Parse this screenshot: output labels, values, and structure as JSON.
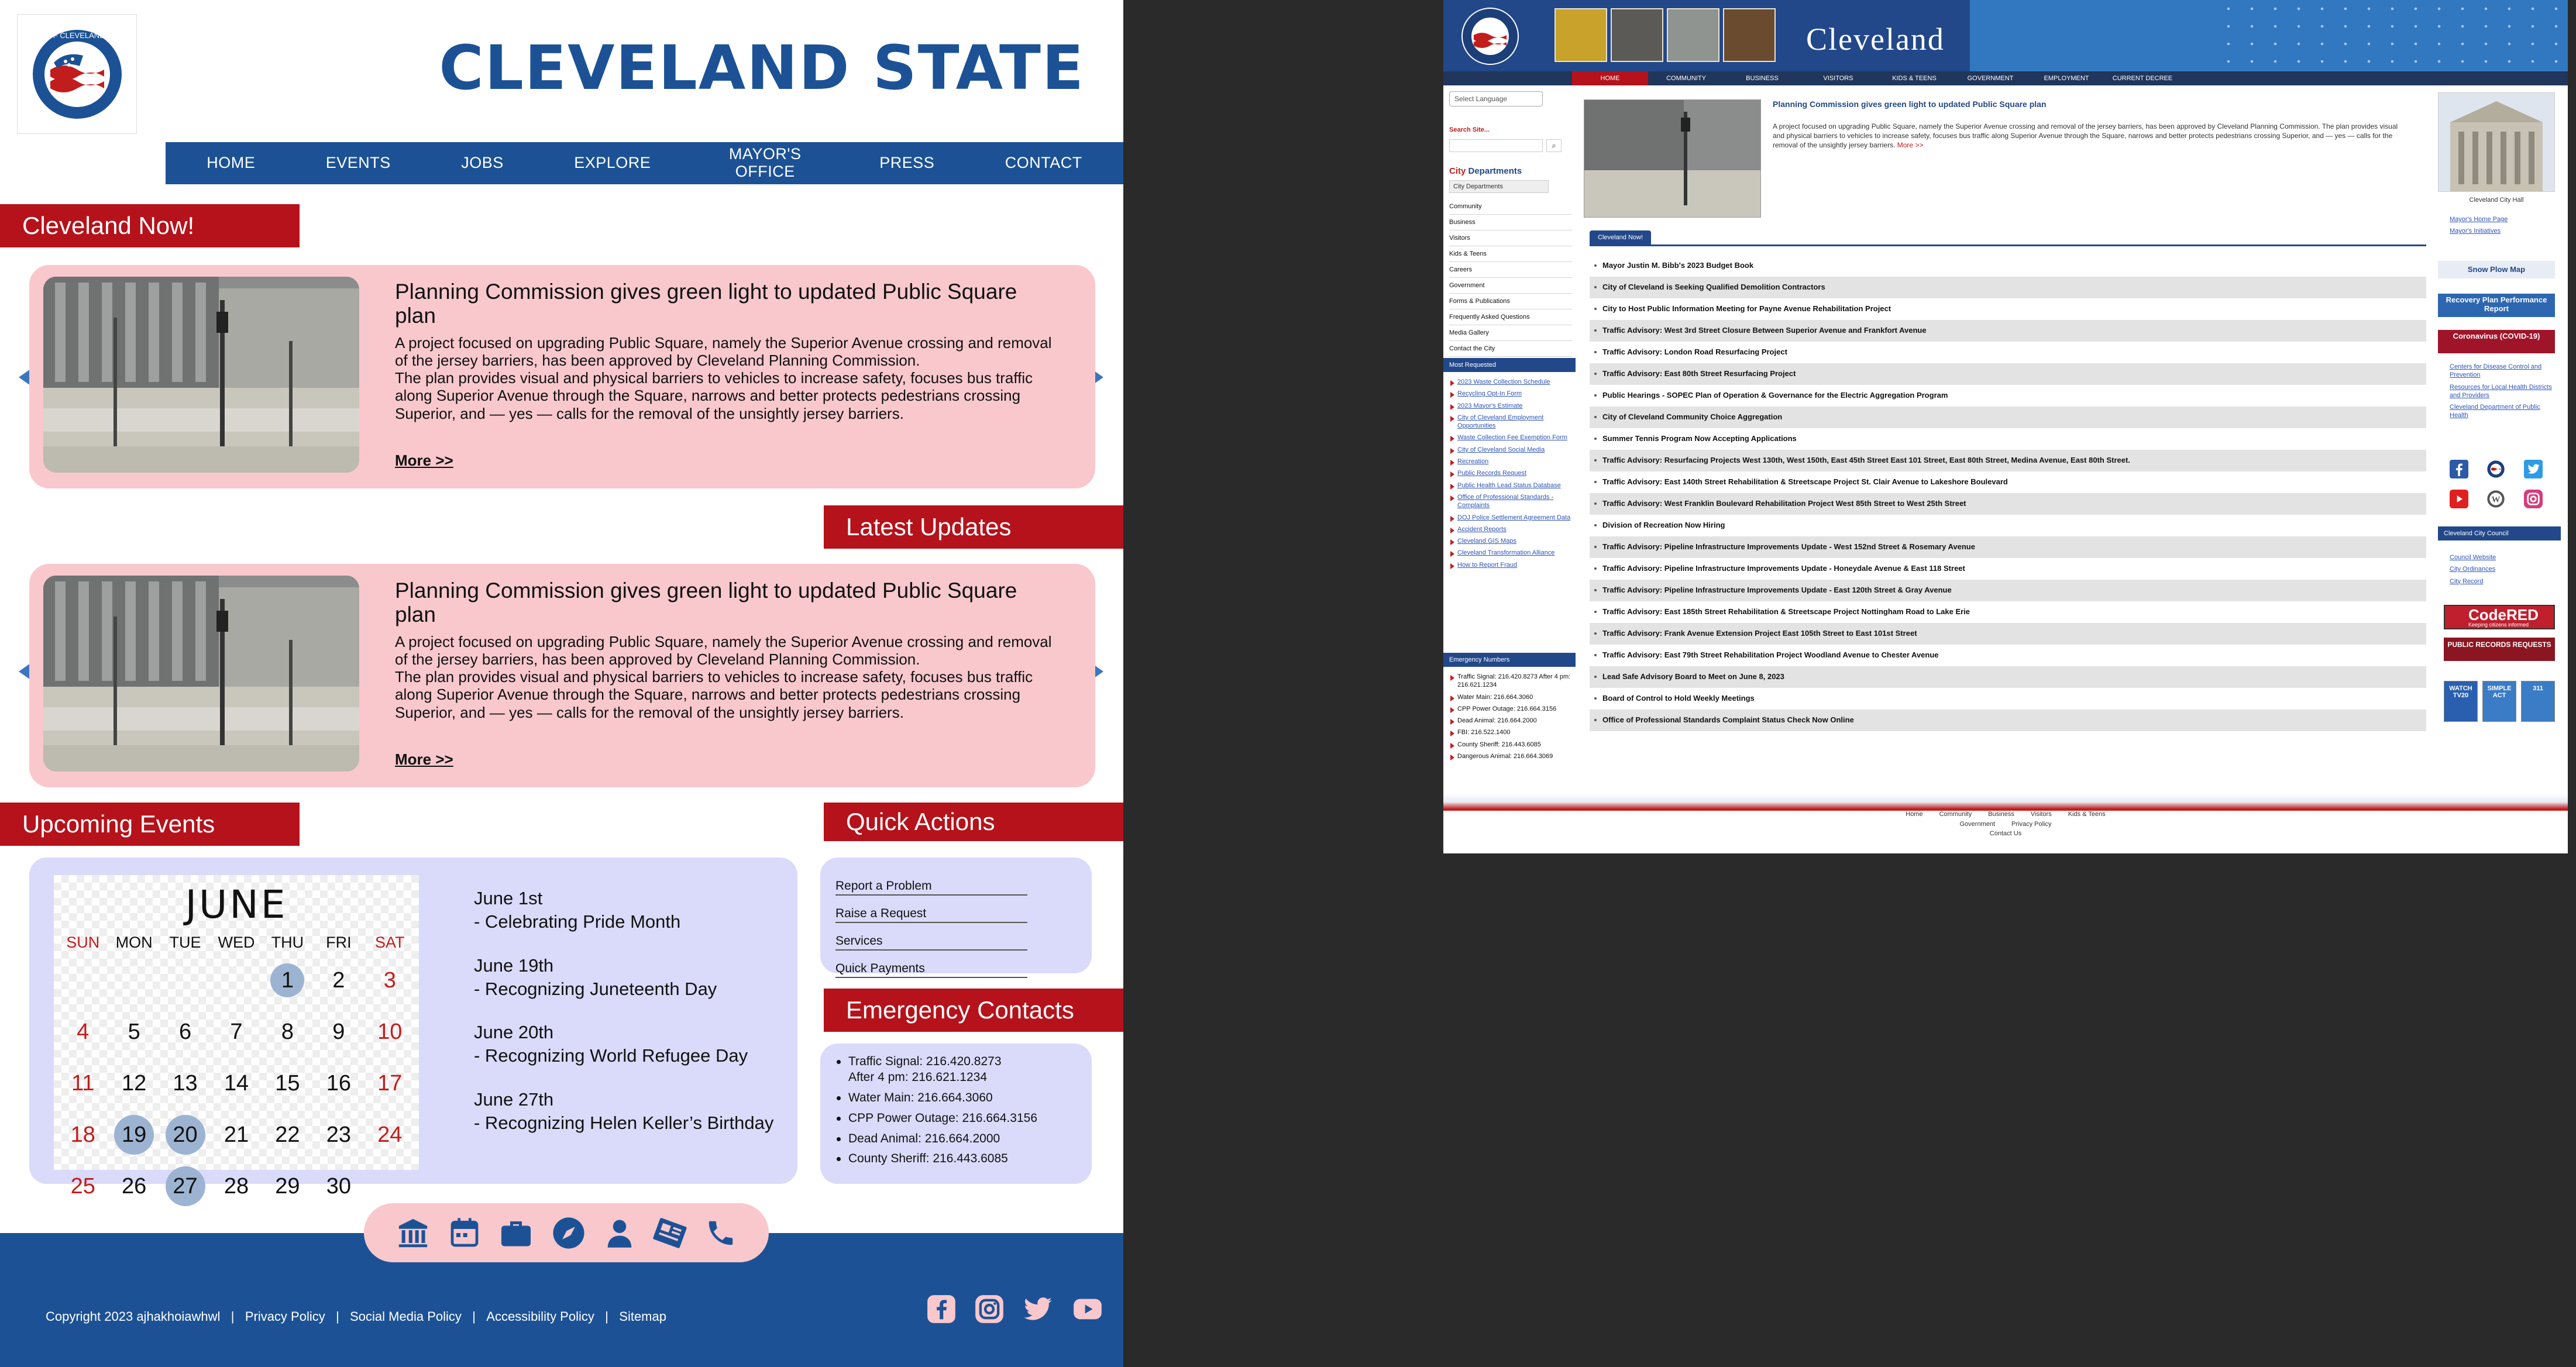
{
  "left": {
    "brand": "CLEVELAND STATE",
    "nav": [
      "HOME",
      "EVENTS",
      "JOBS",
      "EXPLORE",
      "MAYOR'S OFFICE",
      "PRESS",
      "CONTACT"
    ],
    "sections": {
      "now": "Cleveland Now!",
      "latest": "Latest Updates",
      "events": "Upcoming Events",
      "quick": "Quick Actions",
      "emergency": "Emergency Contacts"
    },
    "article": {
      "title": "Planning Commission gives green light to updated Public Square plan",
      "body": "A project focused on upgrading Public Square,  namely the Superior Avenue crossing and removal of the jersey barriers,  has been approved by Cleveland Planning Commission.\nThe plan provides visual and physical barriers to vehicles to increase safety, focuses bus traffic along Superior Avenue through the Square, narrows and better protects pedestrians crossing Superior,  and — yes — calls for the removal of the unsightly jersey barriers.",
      "more": "More >>"
    },
    "calendar": {
      "month": "JUNE",
      "days_of_week": [
        "SUN",
        "MON",
        "TUE",
        "WED",
        "THU",
        "FRI",
        "SAT"
      ],
      "dates": [
        "",
        "",
        "",
        "",
        "1",
        "2",
        "3",
        "4",
        "5",
        "6",
        "7",
        "8",
        "9",
        "10",
        "11",
        "12",
        "13",
        "14",
        "15",
        "16",
        "17",
        "18",
        "19",
        "20",
        "21",
        "22",
        "23",
        "24",
        "25",
        "26",
        "27",
        "28",
        "29",
        "30",
        ""
      ],
      "highlighted": [
        "1",
        "19",
        "20",
        "27"
      ]
    },
    "events": [
      {
        "date": "June 1st",
        "name": "- Celebrating Pride Month"
      },
      {
        "date": "June 19th",
        "name": "- Recognizing Juneteenth Day"
      },
      {
        "date": "June 20th",
        "name": "- Recognizing World Refugee Day"
      },
      {
        "date": "June 27th",
        "name": "- Recognizing Helen Keller’s Birthday"
      }
    ],
    "quick_actions": [
      "Report a Problem",
      "Raise a Request",
      "Services",
      "Quick Payments"
    ],
    "emergency": [
      "Traffic Signal: 216.420.8273\nAfter 4 pm: 216.621.1234",
      "Water Main: 216.664.3060",
      "CPP Power Outage: 216.664.3156",
      "Dead Animal: 216.664.2000",
      "County Sheriff: 216.443.6085"
    ],
    "icon_bar": [
      "building-icon",
      "calendar-icon",
      "briefcase-icon",
      "compass-icon",
      "user-icon",
      "newspaper-icon",
      "phone-icon"
    ],
    "footer": {
      "copyright": "Copyright 2023 ajhakhoiawhwl",
      "links": [
        "Privacy Policy",
        "Social Media Policy",
        "Accessibility Policy",
        "Sitemap"
      ],
      "social": [
        "facebook-icon",
        "instagram-icon",
        "twitter-icon",
        "youtube-icon"
      ]
    }
  },
  "right": {
    "title": "Cleveland",
    "nav": [
      "HOME",
      "COMMUNITY",
      "BUSINESS",
      "VISITORS",
      "KIDS & TEENS",
      "GOVERNMENT",
      "EMPLOYMENT",
      "CURRENT DECREE"
    ],
    "language": "Select Language",
    "search_label": "Search Site...",
    "city_depts_label_a": "City",
    "city_depts_label_b": " Departments",
    "city_depts_select": "City Departments",
    "depts": [
      "Community",
      "Business",
      "Visitors",
      "Kids & Teens",
      "Careers",
      "Government",
      "Forms & Publications",
      "Frequently Asked Questions",
      "Media Gallery",
      "Contact the City"
    ],
    "most_requested_header": "Most Requested",
    "most_requested": [
      "2023 Waste Collection Schedule",
      "Recycling Opt-In Form",
      "2023 Mayor's Estimate",
      "City of Cleveland Employment Opportunities",
      "Waste Collection Fee Exemption Form",
      "City of Cleveland Social Media",
      "Recreation",
      "Public Records Request",
      "Public Health Lead Status Database",
      "Office of Professional Standards - Complaints",
      "DOJ Police Settlement Agreement Data",
      "Accident Reports",
      "Cleveland GIS Maps",
      "Cleveland Transformation Alliance",
      "How to Report Fraud"
    ],
    "emergency_header": "Emergency Numbers",
    "emergency_numbers": [
      "Traffic Signal: 216.420.8273 After 4 pm: 216.621.1234",
      "Water Main: 216.664.3060",
      "CPP Power Outage: 216.664.3156",
      "Dead Animal: 216.664.2000",
      "FBI: 216.522.1400",
      "County Sheriff: 216.443.6085",
      "Dangerous Animal: 216.664.3069"
    ],
    "feature_title": "Planning Commission gives green light to updated Public Square plan",
    "feature_body": "A project focused on upgrading Public Square, namely the Superior Avenue crossing and removal of the jersey barriers, has been approved by Cleveland Planning Commission. The plan provides visual and physical barriers to vehicles to increase safety, focuses bus traffic along Superior Avenue through the Square, narrows and better protects pedestrians crossing Superior, and — yes — calls for the removal of the unsightly jersey barriers.",
    "feature_more": "More >>",
    "cleveland_now_tab": "Cleveland Now!",
    "news": [
      "Mayor Justin M. Bibb's 2023 Budget Book",
      "City of Cleveland is Seeking Qualified Demolition Contractors",
      "City to Host Public Information Meeting for Payne Avenue Rehabilitation Project",
      "Traffic Advisory: West 3rd Street Closure Between Superior Avenue and Frankfort Avenue",
      "Traffic Advisory: London Road Resurfacing Project",
      "Traffic Advisory: East 80th Street Resurfacing Project",
      "Public Hearings - SOPEC Plan of Operation & Governance for the Electric Aggregation Program",
      "City of Cleveland Community Choice Aggregation",
      "Summer Tennis Program Now Accepting Applications",
      "Traffic Advisory: Resurfacing Projects West 130th, West 150th, East 45th Street East 101 Street, East 80th Street, Medina Avenue, East 80th Street.",
      "Traffic Advisory: East 140th Street Rehabilitation & Streetscape Project St. Clair Avenue to Lakeshore Boulevard",
      "Traffic Advisory: West Franklin Boulevard Rehabilitation Project West 85th Street to West 25th Street",
      "Division of Recreation Now Hiring",
      "Traffic Advisory: Pipeline Infrastructure Improvements Update - West 152nd Street & Rosemary Avenue",
      "Traffic Advisory: Pipeline Infrastructure Improvements Update - Honeydale Avenue & East 118 Street",
      "Traffic Advisory: Pipeline Infrastructure Improvements Update - East 120th Street & Gray Avenue",
      "Traffic Advisory: East 185th Street Rehabilitation & Streetscape Project Nottingham Road to Lake Erie",
      "Traffic Advisory: Frank Avenue Extension Project East 105th Street to East 101st Street",
      "Traffic Advisory: East 79th Street Rehabilitation Project Woodland Avenue to Chester Avenue",
      "Lead Safe Advisory Board to Meet on June 8, 2023",
      "Board of Control to Hold Weekly Meetings",
      "Office of Professional Standards Complaint Status Check Now Online"
    ],
    "city_hall_caption": "Cleveland City Hall",
    "mayor_links": [
      "Mayor's Home Page",
      "Mayor's Initiatives"
    ],
    "snow_plow": "Snow Plow Map",
    "recovery": "Recovery Plan Performance Report",
    "covid": "Coronavirus (COVID-19)",
    "covid_links": [
      "Centers for Disease Control and Prevention",
      "Resources for Local Health Districts and Providers",
      "Cleveland Department of Public Health"
    ],
    "council_header": "Cleveland City Council",
    "council_links": [
      "Council Website",
      "City Ordinances",
      "City Record"
    ],
    "code_red": "CodeRED",
    "code_red_sub": "Keeping citizens informed",
    "public_records": "PUBLIC RECORDS REQUESTS",
    "tiles": [
      "WATCH TV20",
      "SIMPLE ACT",
      "311"
    ],
    "footer_links": [
      "Home",
      "Community",
      "Business",
      "Visitors",
      "Kids & Teens",
      "Government",
      "Privacy Policy",
      "Contact Us"
    ]
  },
  "colors": {
    "brand_blue": "#1c5295",
    "accent_red": "#b5121b",
    "card_pink": "#f8c8cd",
    "panel_lavender": "#dadbfa"
  }
}
